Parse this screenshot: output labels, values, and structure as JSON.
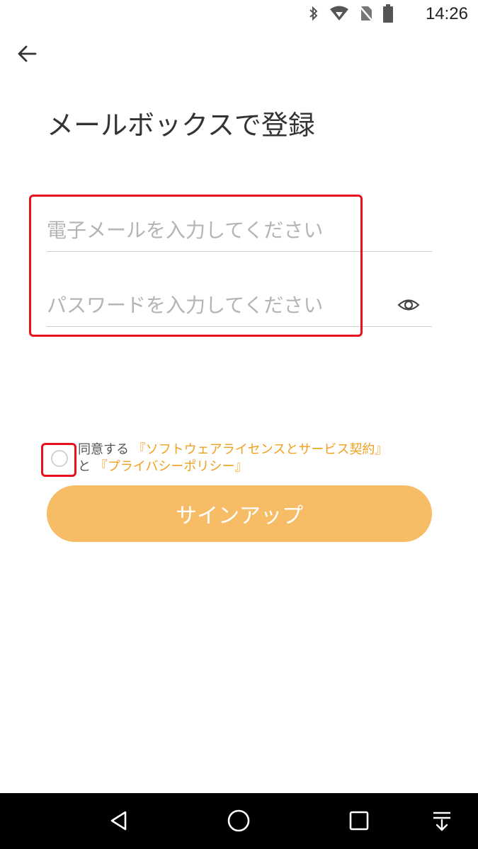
{
  "status_bar": {
    "time": "14:26",
    "icons": [
      "bluetooth-icon",
      "wifi-icon",
      "no-sim-icon",
      "battery-icon"
    ]
  },
  "header": {
    "back_icon": "arrow-left-icon",
    "title": "メールボックスで登録"
  },
  "form": {
    "email_placeholder": "電子メールを入力してください",
    "email_value": "",
    "password_placeholder": "パスワードを入力してください",
    "password_value": "",
    "password_toggle_icon": "eye-icon"
  },
  "agreement": {
    "checked": false,
    "prefix": "同意する",
    "terms_link": "『ソフトウェアライセンスとサービス契約』",
    "conjunction": "と",
    "privacy_link": "『プライバシーポリシー』"
  },
  "signup_button": {
    "label": "サインアップ"
  },
  "nav_bar": {
    "buttons": [
      "back-triangle-icon",
      "home-circle-icon",
      "recents-square-icon",
      "notification-down-icon"
    ]
  },
  "colors": {
    "accent": "#f6bc66",
    "link": "#f0a020",
    "highlight": "#e8101a",
    "nav_background": "#000000"
  }
}
